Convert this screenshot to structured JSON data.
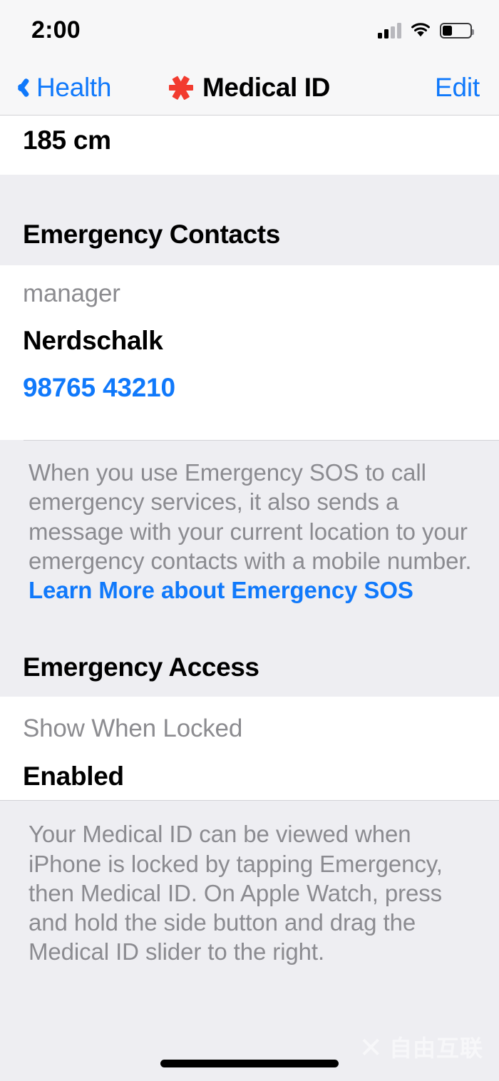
{
  "status_bar": {
    "time": "2:00",
    "signal_icon": "cellular-signal-icon",
    "signal_bars_filled": 2,
    "signal_bars_total": 4,
    "wifi_icon": "wifi-icon",
    "battery_icon": "battery-icon",
    "battery_level_percent": 35
  },
  "nav_bar": {
    "back_icon": "chevron-left-icon",
    "back_label": "Health",
    "title_icon": "medical-id-asterisk-icon",
    "title": "Medical ID",
    "edit_label": "Edit"
  },
  "sections": {
    "height_row": {
      "value": "185 cm"
    },
    "emergency_contacts": {
      "header": "Emergency Contacts",
      "contact": {
        "relationship": "manager",
        "name": "Nerdschalk",
        "phone": "98765 43210"
      },
      "footer": {
        "text_before_link": "When you use Emergency SOS to call emergency services, it also sends a message with your current location to your emergency contacts with a mobile number. ",
        "link_text": "Learn More about Emergency SOS"
      }
    },
    "emergency_access": {
      "header": "Emergency Access",
      "show_when_locked": {
        "label": "Show When Locked",
        "value": "Enabled"
      },
      "footer": {
        "text": "Your Medical ID can be viewed when iPhone is locked by tapping Emergency, then Medical ID. On Apple Watch, press and hold the side button and drag the Medical ID slider to the right."
      }
    }
  },
  "watermark": {
    "logo": "x-logo-icon",
    "text": "自由互联"
  },
  "colors": {
    "accent_blue": "#1079fb",
    "medical_red": "#f23b2f",
    "group_background": "#eeeef2",
    "row_background": "#ffffff",
    "secondary_text": "#8c8c90",
    "bar_background": "#f7f7f8"
  }
}
